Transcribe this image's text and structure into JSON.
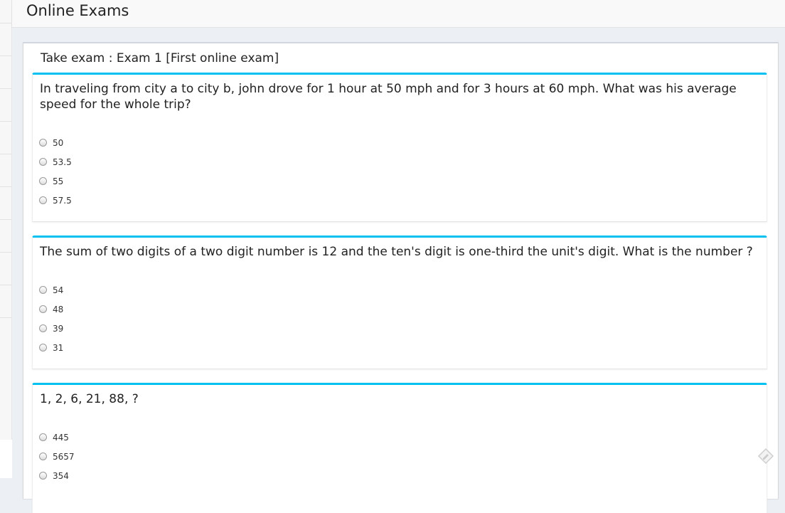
{
  "header": {
    "title": "Online Exams"
  },
  "exam": {
    "title": "Take exam : Exam 1 [First online exam]"
  },
  "questions": [
    {
      "text": "In traveling from city a to city b, john drove for 1 hour at 50 mph and for 3 hours at 60 mph. What was his average speed for the whole trip?",
      "options": [
        "50",
        "53.5",
        "55",
        "57.5"
      ]
    },
    {
      "text": "The sum of two digits of a two digit number is 12 and the ten's digit is one-third the unit's digit. What is the number ?",
      "options": [
        "54",
        "48",
        "39",
        "31"
      ]
    },
    {
      "text": "1, 2, 6, 21, 88, ?",
      "options": [
        "445",
        "5657",
        "354"
      ]
    }
  ],
  "icons": {
    "corner": "edit-icon"
  },
  "colors": {
    "accent": "#00c0ef",
    "background": "#ecf0f5"
  }
}
